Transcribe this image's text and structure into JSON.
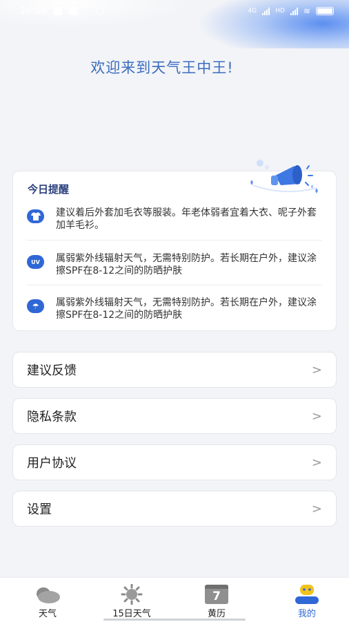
{
  "status_bar": {
    "time": "16:09",
    "network_labels": [
      "4G",
      "HD",
      "4G"
    ]
  },
  "header": {
    "welcome": "欢迎来到天气王中王!"
  },
  "reminder": {
    "title": "今日提醒",
    "items": [
      {
        "icon": "shirt-icon",
        "glyph": "👕",
        "text": "建议着后外套加毛衣等服装。年老体弱者宜着大衣、呢子外套加羊毛衫。"
      },
      {
        "icon": "uv-icon",
        "glyph": "UV",
        "text": "属弱紫外线辐射天气，无需特别防护。若长期在户外，建议涂擦SPF在8-12之间的防晒护肤"
      },
      {
        "icon": "umbrella-icon",
        "glyph": "☂",
        "text": "属弱紫外线辐射天气，无需特别防护。若长期在户外，建议涂擦SPF在8-12之间的防晒护肤"
      }
    ]
  },
  "menu": {
    "feedback": "建议反馈",
    "privacy": "隐私条款",
    "agreement": "用户协议",
    "settings": "设置",
    "chevron": ">"
  },
  "tabbar": {
    "weather": "天气",
    "forecast": "15日天气",
    "calendar": "黄历",
    "calendar_day": "7",
    "mine": "我的"
  },
  "colors": {
    "accent": "#2f67d6",
    "welcome": "#3b6cc0",
    "background": "#f3f4f7"
  }
}
